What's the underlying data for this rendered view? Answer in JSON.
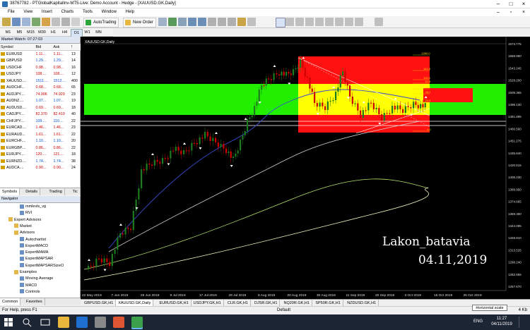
{
  "window": {
    "title": "38767782 - PTGlobalKapitalInv-MT5-Live: Demo Account - Hedge - [XAUUSD.GK,Daily]"
  },
  "menu": [
    "File",
    "View",
    "Insert",
    "Charts",
    "Tools",
    "Window",
    "Help"
  ],
  "toolbar": {
    "autotrading": "AutoTrading",
    "new_order": "New Order"
  },
  "timeframes": [
    "M1",
    "M5",
    "M15",
    "M30",
    "H1",
    "H4",
    "D1",
    "W1",
    "MN"
  ],
  "timeframe_active": "D1",
  "market_watch": {
    "title": "Market Watch: 07:27:03",
    "columns": [
      "Symbol",
      "Bid",
      "Ask",
      "!"
    ],
    "rows": [
      {
        "symbol": "EURUSD",
        "bid": "1.11...",
        "ask": "1.11...",
        "spread": "13"
      },
      {
        "symbol": "GBPUSD",
        "bid": "1.29...",
        "ask": "1.29...",
        "spread": "14"
      },
      {
        "symbol": "USDCHF",
        "bid": "0.98...",
        "ask": "0.98...",
        "spread": "16"
      },
      {
        "symbol": "USDJPY",
        "bid": "108....",
        "ask": "108....",
        "spread": "12"
      },
      {
        "symbol": "XAUUSD....",
        "bid": "1511....",
        "ask": "1512....",
        "spread": "400"
      },
      {
        "symbol": "AUDCHF...",
        "bid": "0.68...",
        "ask": "0.68...",
        "spread": "65"
      },
      {
        "symbol": "AUDJPY....",
        "bid": "74.906",
        "ask": "74.929",
        "spread": "23"
      },
      {
        "symbol": "AUDNZ....",
        "bid": "1.07...",
        "ask": "1.07...",
        "spread": "19"
      },
      {
        "symbol": "AUDUSD....",
        "bid": "0.69...",
        "ask": "0.69...",
        "spread": "18"
      },
      {
        "symbol": "CADJPY....",
        "bid": "82.370",
        "ask": "82.410",
        "spread": "40"
      },
      {
        "symbol": "CHFJPY....",
        "bid": "109....",
        "ask": "110....",
        "spread": "22"
      },
      {
        "symbol": "EURCAD....",
        "bid": "1.46...",
        "ask": "1.46...",
        "spread": "23"
      },
      {
        "symbol": "EURAUD...",
        "bid": "1.61...",
        "ask": "1.61...",
        "spread": "22"
      },
      {
        "symbol": "EURCHF....",
        "bid": "1.10...",
        "ask": "1.10...",
        "spread": "20"
      },
      {
        "symbol": "EURGBP....",
        "bid": "0.86...",
        "ask": "0.86...",
        "spread": "22"
      },
      {
        "symbol": "EURJPY....",
        "bid": "120....",
        "ask": "121....",
        "spread": "18"
      },
      {
        "symbol": "EURNZD....",
        "bid": "1.74...",
        "ask": "1.74...",
        "spread": "38"
      },
      {
        "symbol": "AUDCA....",
        "bid": "0.90...",
        "ask": "0.90...",
        "spread": "24"
      }
    ],
    "tabs": [
      "Symbols",
      "Details",
      "Trading",
      "Tic"
    ]
  },
  "navigator": {
    "title": "Navigator",
    "items": [
      {
        "label": "mmlevls_vg",
        "indent": 3,
        "kind": "indicator"
      },
      {
        "label": "RVI",
        "indent": 3,
        "kind": "indicator"
      },
      {
        "label": "Expert Advisors",
        "indent": 1,
        "kind": "folder"
      },
      {
        "label": "Market",
        "indent": 2,
        "kind": "folder"
      },
      {
        "label": "Advisors",
        "indent": 2,
        "kind": "folder"
      },
      {
        "label": "Autochartist",
        "indent": 3,
        "kind": "expert"
      },
      {
        "label": "ExpertMACD",
        "indent": 3,
        "kind": "expert"
      },
      {
        "label": "ExpertMAMA",
        "indent": 3,
        "kind": "expert"
      },
      {
        "label": "ExpertMAPSAR",
        "indent": 3,
        "kind": "expert"
      },
      {
        "label": "ExpertMAPSARSizeO",
        "indent": 3,
        "kind": "expert"
      },
      {
        "label": "Examples",
        "indent": 2,
        "kind": "folder"
      },
      {
        "label": "Moving Average",
        "indent": 3,
        "kind": "expert"
      },
      {
        "label": "MACD",
        "indent": 3,
        "kind": "expert"
      },
      {
        "label": "Controls",
        "indent": 3,
        "kind": "expert"
      }
    ],
    "tabs": [
      "Common",
      "Favorites"
    ]
  },
  "chart": {
    "label": "XAUUSD.GK,Daily",
    "price_labels": [
      "1573.775",
      "1558.990",
      "1543.245",
      "1528.200",
      "1509.365",
      "1496.130",
      "1481.895",
      "1466.560",
      "1451.275",
      "1435.840",
      "1420.515",
      "1405.230",
      "1389.950",
      "1374.665",
      "1359.380",
      "1344.095",
      "1328.810",
      "1313.525",
      "1298.240",
      "1282.955",
      "1267.670"
    ],
    "date_labels": [
      "22 May 2019",
      "7 Jun 2019",
      "25 Jun 2019",
      "9 Jul 2019",
      "17 Jul 2019",
      "29 Jul 2019",
      "8 Aug 2019",
      "20 Aug 2019",
      "30 Aug 2019",
      "11 Sep 2019",
      "20 Sep 2019",
      "3 Oct 2019",
      "15 Oct 2019",
      "25 Oct 2019"
    ],
    "fib_labels": [
      "1260.0",
      "161.8",
      "100.0",
      "61.8",
      "50.0",
      "38.2",
      "23.6",
      "0.0"
    ],
    "signature": [
      "Lakon_batavia",
      "04.11,2019"
    ],
    "colors": {
      "green_zone": "#22ee00",
      "red_zone": "#ff1111",
      "yellow_zone": "#ffff00",
      "bull": "#1e7a1e",
      "bear": "#cc0000"
    }
  },
  "symbol_tabs": [
    "GBPUSD.GK,H1",
    "XAUUSD.GK,Daily",
    "EURUSD.GK,H1",
    "USDJPY.GK,H1",
    "CLR.GK,H1",
    "DJSR.GK,H1",
    "NQ20R.GK,H1",
    "SP50R.GK,H1",
    "NZDUSD.GK,H1"
  ],
  "symbol_tab_active": "XAUUSD.GK,Daily",
  "status": {
    "help": "For Help, press F1",
    "profile": "Default",
    "right": "4 Kb",
    "tooltip": "Horizontal scale"
  },
  "taskbar": {
    "time": "11:27",
    "date": "04/11/2019",
    "lang": "ENG"
  }
}
